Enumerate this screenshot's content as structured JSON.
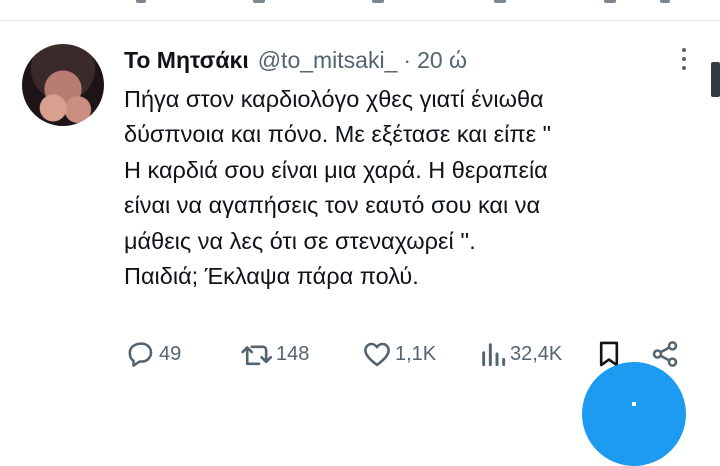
{
  "tweet": {
    "display_name": "Το Μητσάκι",
    "handle": "@to_mitsaki_",
    "separator": "·",
    "time": "20 ώ",
    "text_lines": [
      "Πήγα στον καρδιολόγο χθες γιατί ένιωθα",
      "δύσπνοια και πόνο. Με εξέτασε και είπε \"",
      "Η καρδιά σου είναι μια χαρά. Η θεραπεία",
      "είναι να αγαπήσεις τον εαυτό σου και να",
      "μάθεις να λες ότι σε στεναχωρεί ''.",
      "Παιδιά; Έκλαψα πάρα πολύ."
    ]
  },
  "actions": {
    "replies": "49",
    "retweets": "148",
    "likes": "1,1K",
    "views": "32,4K"
  },
  "icons": {
    "reply": "reply-icon",
    "retweet": "retweet-icon",
    "like": "heart-icon",
    "views": "views-icon",
    "bookmark": "bookmark-icon",
    "share": "share-icon",
    "more": "more-icon",
    "compose": "compose-icon"
  },
  "colors": {
    "text": "#0f1419",
    "secondary": "#536471",
    "accent": "#1d9bf0",
    "divider": "#e6ebef"
  }
}
